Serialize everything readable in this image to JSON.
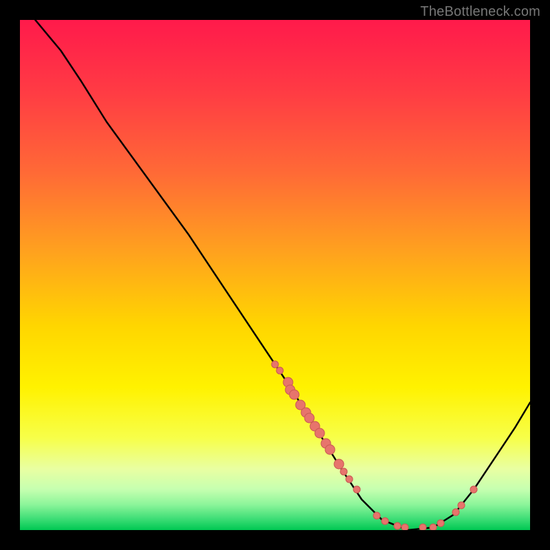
{
  "watermark": "TheBottleneck.com",
  "colors": {
    "black": "#000000",
    "curve": "#000000",
    "dot_fill": "#e7746c",
    "dot_stroke": "#c85a52"
  },
  "chart_data": {
    "type": "line",
    "title": "",
    "xlabel": "",
    "ylabel": "",
    "xlim": [
      0,
      100
    ],
    "ylim": [
      0,
      100
    ],
    "grid": false,
    "legend": false,
    "gradient_stops": [
      {
        "offset": 0,
        "color": "#ff1a4b"
      },
      {
        "offset": 14,
        "color": "#ff3b44"
      },
      {
        "offset": 30,
        "color": "#ff6a36"
      },
      {
        "offset": 45,
        "color": "#ffa01f"
      },
      {
        "offset": 60,
        "color": "#ffd600"
      },
      {
        "offset": 72,
        "color": "#fff200"
      },
      {
        "offset": 82,
        "color": "#f7ff4a"
      },
      {
        "offset": 88,
        "color": "#e9ffa2"
      },
      {
        "offset": 92,
        "color": "#c6ffb0"
      },
      {
        "offset": 95,
        "color": "#8cf59a"
      },
      {
        "offset": 97.5,
        "color": "#46e07a"
      },
      {
        "offset": 100,
        "color": "#00c853"
      }
    ],
    "curve": [
      {
        "x": 3,
        "y": 100
      },
      {
        "x": 8,
        "y": 94
      },
      {
        "x": 12,
        "y": 88
      },
      {
        "x": 17,
        "y": 80
      },
      {
        "x": 25,
        "y": 69
      },
      {
        "x": 33,
        "y": 58
      },
      {
        "x": 41,
        "y": 46
      },
      {
        "x": 47,
        "y": 37
      },
      {
        "x": 53,
        "y": 28
      },
      {
        "x": 58,
        "y": 20
      },
      {
        "x": 63,
        "y": 12
      },
      {
        "x": 67,
        "y": 6
      },
      {
        "x": 71,
        "y": 2
      },
      {
        "x": 76,
        "y": 0
      },
      {
        "x": 81,
        "y": 0.5
      },
      {
        "x": 85,
        "y": 3
      },
      {
        "x": 89,
        "y": 8
      },
      {
        "x": 93,
        "y": 14
      },
      {
        "x": 97,
        "y": 20
      },
      {
        "x": 100,
        "y": 25
      }
    ],
    "points": [
      {
        "x": 50.0,
        "y": 32.5,
        "r": 5.5
      },
      {
        "x": 51.0,
        "y": 31.2,
        "r": 5.5
      },
      {
        "x": 52.5,
        "y": 29.0,
        "r": 7.5
      },
      {
        "x": 53.0,
        "y": 27.5,
        "r": 7.5
      },
      {
        "x": 53.8,
        "y": 26.5,
        "r": 7.5
      },
      {
        "x": 55.0,
        "y": 24.5,
        "r": 7.5
      },
      {
        "x": 56.0,
        "y": 23.0,
        "r": 7.5
      },
      {
        "x": 56.8,
        "y": 22.0,
        "r": 7.5
      },
      {
        "x": 57.8,
        "y": 20.4,
        "r": 7.5
      },
      {
        "x": 58.8,
        "y": 19.0,
        "r": 7.5
      },
      {
        "x": 60.0,
        "y": 17.0,
        "r": 7.5
      },
      {
        "x": 60.8,
        "y": 15.8,
        "r": 7.5
      },
      {
        "x": 62.5,
        "y": 13.0,
        "r": 7.5
      },
      {
        "x": 63.5,
        "y": 11.5,
        "r": 5.5
      },
      {
        "x": 64.5,
        "y": 10.0,
        "r": 5.5
      },
      {
        "x": 66.0,
        "y": 8.0,
        "r": 5.5
      },
      {
        "x": 70.0,
        "y": 2.8,
        "r": 5.5
      },
      {
        "x": 71.5,
        "y": 1.8,
        "r": 5.5
      },
      {
        "x": 74.0,
        "y": 0.8,
        "r": 5.5
      },
      {
        "x": 75.5,
        "y": 0.5,
        "r": 5.5
      },
      {
        "x": 79.0,
        "y": 0.6,
        "r": 5.5
      },
      {
        "x": 81.0,
        "y": 0.6,
        "r": 5.5
      },
      {
        "x": 82.5,
        "y": 1.3,
        "r": 5.5
      },
      {
        "x": 85.5,
        "y": 3.5,
        "r": 5.5
      },
      {
        "x": 86.5,
        "y": 4.8,
        "r": 5.5
      },
      {
        "x": 89.0,
        "y": 8.0,
        "r": 5.5
      }
    ]
  }
}
